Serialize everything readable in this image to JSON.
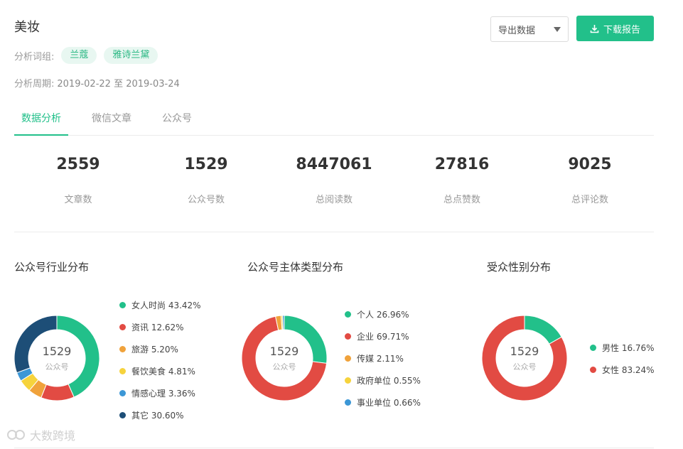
{
  "header": {
    "title": "美妆",
    "groups_label": "分析词组:",
    "tags": [
      "兰蔻",
      "雅诗兰黛"
    ],
    "period_label": "分析周期:",
    "period_value": "2019-02-22 至 2019-03-24",
    "export_label": "导出数据",
    "download_label": "下载报告"
  },
  "tabs": [
    {
      "label": "数据分析",
      "active": true
    },
    {
      "label": "微信文章",
      "active": false
    },
    {
      "label": "公众号",
      "active": false
    }
  ],
  "stats": [
    {
      "value": "2559",
      "label": "文章数"
    },
    {
      "value": "1529",
      "label": "公众号数"
    },
    {
      "value": "8447061",
      "label": "总阅读数"
    },
    {
      "value": "27816",
      "label": "总点赞数"
    },
    {
      "value": "9025",
      "label": "总评论数"
    }
  ],
  "chart_data": [
    {
      "type": "pie",
      "title": "公众号行业分布",
      "center_value": "1529",
      "center_label": "公众号",
      "slices": [
        {
          "label": "女人时尚",
          "pct_text": "43.42%",
          "value": 43.42,
          "color": "#22c08a"
        },
        {
          "label": "资讯",
          "pct_text": "12.62%",
          "value": 12.62,
          "color": "#e24b43"
        },
        {
          "label": "旅游",
          "pct_text": "5.20%",
          "value": 5.2,
          "color": "#f0a23b"
        },
        {
          "label": "餐饮美食",
          "pct_text": "4.81%",
          "value": 4.81,
          "color": "#f6d33c"
        },
        {
          "label": "情感心理",
          "pct_text": "3.36%",
          "value": 3.36,
          "color": "#3c97d6"
        },
        {
          "label": "其它",
          "pct_text": "30.60%",
          "value": 30.6,
          "color": "#1d4e77"
        }
      ]
    },
    {
      "type": "pie",
      "title": "公众号主体类型分布",
      "center_value": "1529",
      "center_label": "公众号",
      "slices": [
        {
          "label": "个人",
          "pct_text": "26.96%",
          "value": 26.96,
          "color": "#22c08a"
        },
        {
          "label": "企业",
          "pct_text": "69.71%",
          "value": 69.71,
          "color": "#e24b43"
        },
        {
          "label": "传媒",
          "pct_text": "2.11%",
          "value": 2.11,
          "color": "#f0a23b"
        },
        {
          "label": "政府单位",
          "pct_text": "0.55%",
          "value": 0.55,
          "color": "#f6d33c"
        },
        {
          "label": "事业单位",
          "pct_text": "0.66%",
          "value": 0.66,
          "color": "#3c97d6"
        }
      ]
    },
    {
      "type": "pie",
      "title": "受众性别分布",
      "center_value": "1529",
      "center_label": "公众号",
      "slices": [
        {
          "label": "男性",
          "pct_text": "16.76%",
          "value": 16.76,
          "color": "#22c08a"
        },
        {
          "label": "女性",
          "pct_text": "83.24%",
          "value": 83.24,
          "color": "#e24b43"
        }
      ]
    }
  ],
  "watermark": "大数跨境"
}
